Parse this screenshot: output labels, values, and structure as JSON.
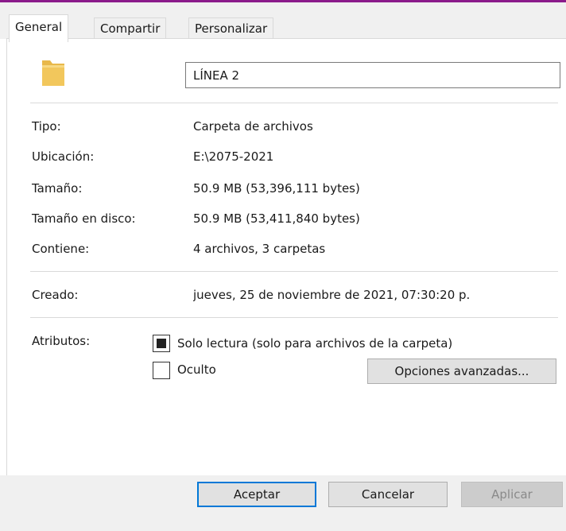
{
  "tabs": [
    {
      "label": "General",
      "active": true
    },
    {
      "label": "Compartir",
      "active": false
    },
    {
      "label": "Personalizar",
      "active": false
    }
  ],
  "header": {
    "folder_icon": "folder-icon",
    "name_value": "LÍNEA 2"
  },
  "properties": {
    "tipo_label": "Tipo:",
    "tipo_value": "Carpeta de archivos",
    "ubicacion_label": "Ubicación:",
    "ubicacion_value": "E:\\2075-2021",
    "tamano_label": "Tamaño:",
    "tamano_value": "50.9 MB (53,396,111 bytes)",
    "tamano_disco_label": "Tamaño en disco:",
    "tamano_disco_value": "50.9 MB (53,411,840 bytes)",
    "contiene_label": "Contiene:",
    "contiene_value": "4 archivos, 3 carpetas",
    "creado_label": "Creado:",
    "creado_value": "jueves, 25 de noviembre de 2021, 07:30:20 p."
  },
  "attributes": {
    "label": "Atributos:",
    "readonly_label": "Solo lectura (solo para archivos de la carpeta)",
    "readonly_state": "indeterminate",
    "hidden_label": "Oculto",
    "hidden_checked": false,
    "advanced_button": "Opciones avanzadas..."
  },
  "footer": {
    "ok_label": "Aceptar",
    "cancel_label": "Cancelar",
    "apply_label": "Aplicar"
  },
  "colors": {
    "accent_top": "#8b1a8b",
    "default_button_border": "#0078d7",
    "folder_yellow": "#f2c75c"
  }
}
